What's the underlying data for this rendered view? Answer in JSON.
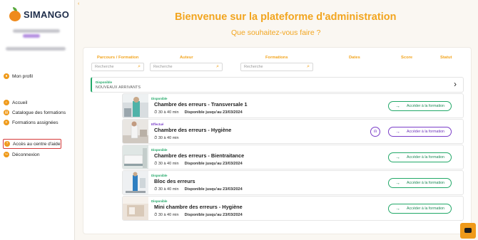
{
  "sidebar": {
    "logo": "SIMANGO",
    "menu": [
      {
        "label": "Mon profil",
        "icon": "user-icon"
      },
      {
        "label": "Accueil",
        "icon": "home-icon"
      },
      {
        "label": "Catalogue des formations",
        "icon": "catalog-icon"
      },
      {
        "label": "Formations assignées",
        "icon": "assigned-icon"
      },
      {
        "label": "Accès au centre d'aide",
        "icon": "help-icon"
      },
      {
        "label": "Déconnexion",
        "icon": "logout-icon"
      }
    ]
  },
  "main": {
    "title": "Bienvenue sur la plateforme d'administration",
    "subtitle": "Que souhaitez-vous faire ?"
  },
  "filters": {
    "columns": [
      "Parcours / Formation",
      "Auteur",
      "Formations",
      "Dates",
      "Score",
      "Statut"
    ],
    "search_placeholder": "Recherche"
  },
  "section": {
    "status": "Disponible",
    "label": "NOUVEAUX ARRIVANTS"
  },
  "courses": [
    {
      "status": "Disponible",
      "status_color": "#22a868",
      "title": "Chambre des erreurs - Transversale 1",
      "duration": "30 à 40 min",
      "availability": "Disponible jusqu'au 23/03/2024",
      "button": "Accéder à la formation",
      "style": "green"
    },
    {
      "status": "Effectué",
      "status_color": "#7a3dc8",
      "title": "Chambre des erreurs - Hygiène",
      "duration": "30 à 40 min",
      "availability": "",
      "button": "Accéder à la formation",
      "style": "purple"
    },
    {
      "status": "Disponible",
      "status_color": "#22a868",
      "title": "Chambre des erreurs - Bientraitance",
      "duration": "30 à 40 min",
      "availability": "Disponible jusqu'au 23/03/2024",
      "button": "Accéder à la formation",
      "style": "green"
    },
    {
      "status": "Disponible",
      "status_color": "#22a868",
      "title": "Bloc des erreurs",
      "duration": "30 à 40 min",
      "availability": "Disponible jusqu'au 23/03/2024",
      "button": "Accéder à la formation",
      "style": "green"
    },
    {
      "status": "Disponible",
      "status_color": "#22a868",
      "title": "Mini chambre des erreurs - Hygiène",
      "duration": "30 à 40 min",
      "availability": "Disponible jusqu'au 23/03/2024",
      "button": "Accéder à la formation",
      "style": "green"
    }
  ],
  "colors": {
    "accent": "#f2a51f",
    "available": "#22a868",
    "done": "#7a3dc8",
    "highlight": "#d63a3a"
  }
}
